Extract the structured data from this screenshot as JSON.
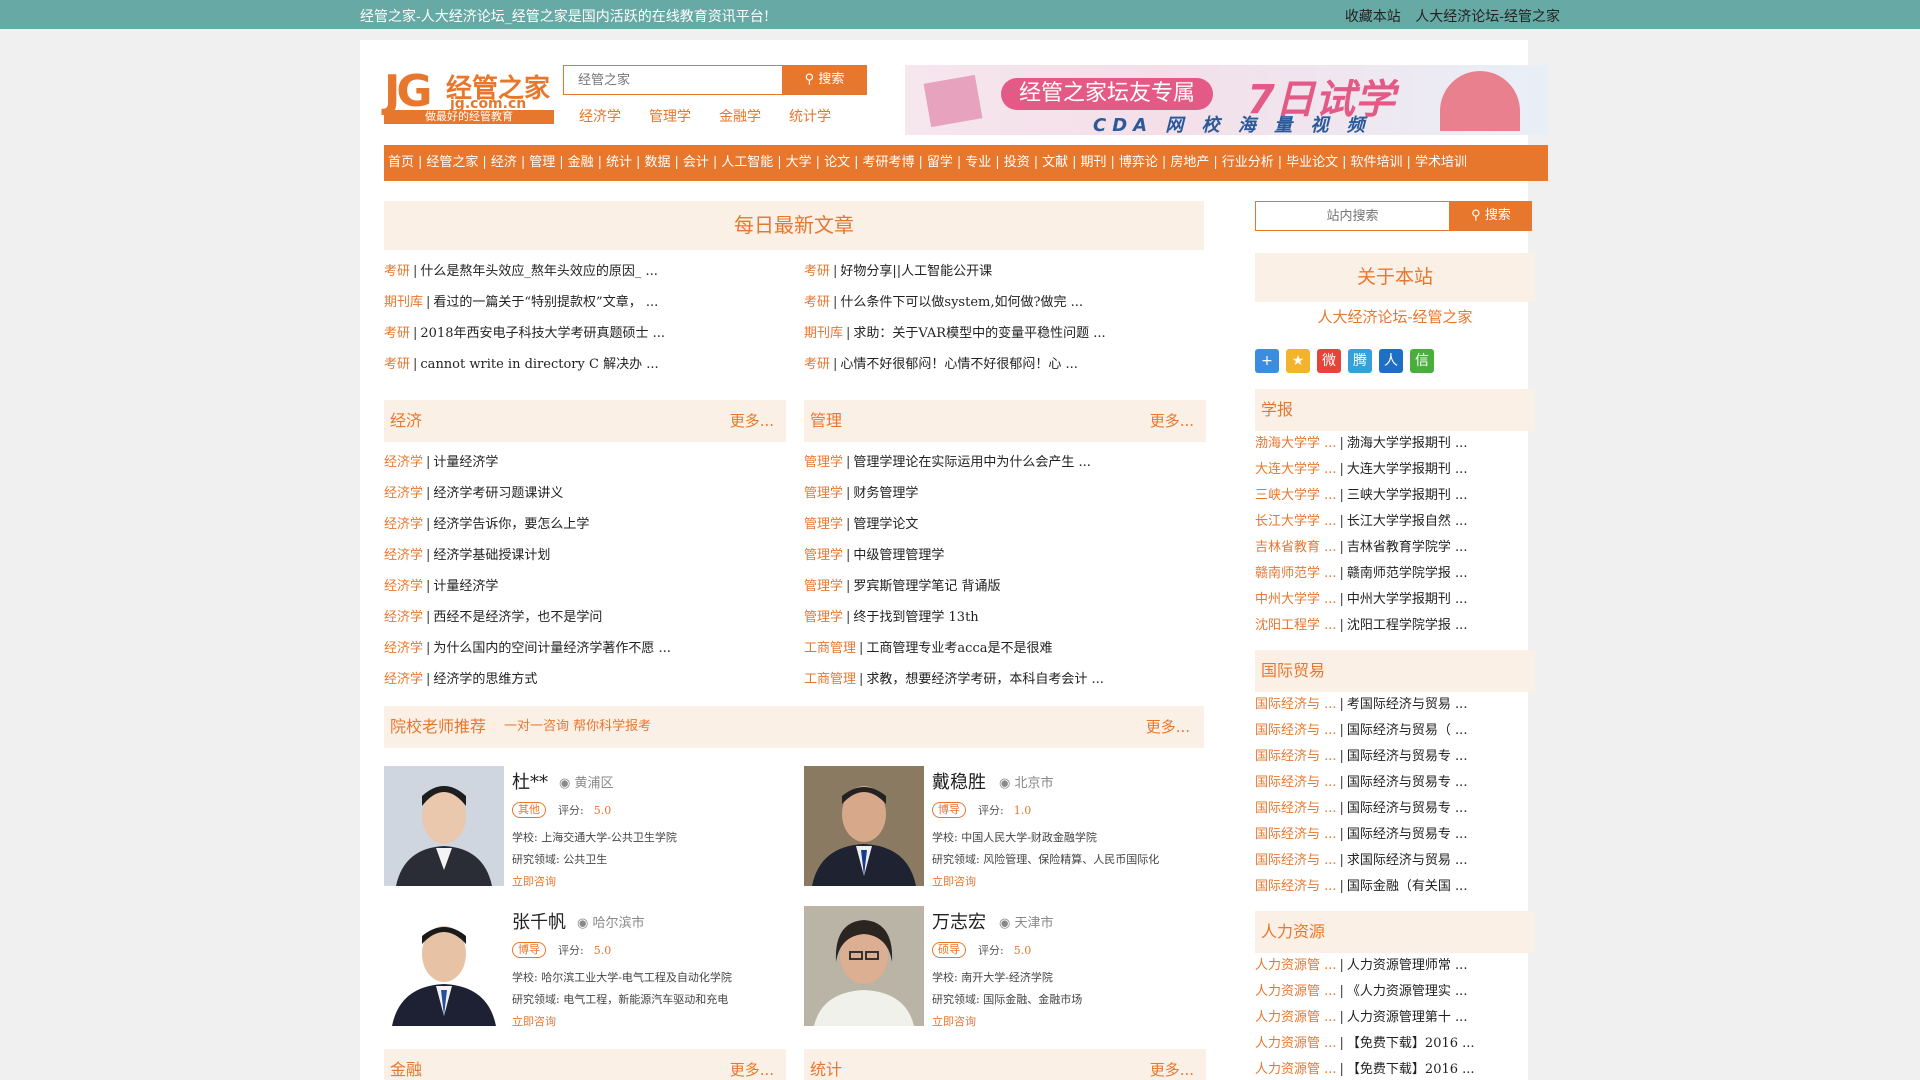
{
  "topbar": {
    "slogan": "经管之家-人大经济论坛_经管之家是国内活跃的在线教育资讯平台!",
    "bookmark": "收藏本站",
    "site_name": "人大经济论坛-经管之家"
  },
  "logo": {
    "jg": "JG",
    "cn": "经管之家",
    "url": "jg.com.cn",
    "tagline": "做最好的经管教育"
  },
  "search": {
    "placeholder": "经管之家",
    "button": "搜索"
  },
  "subnav": [
    "经济学",
    "管理学",
    "金融学",
    "统计学"
  ],
  "banner": {
    "pill": "经管之家坛友专属",
    "big": "7日试学",
    "sub": "CDA 网 校 海 量 视 频"
  },
  "mainnav": [
    "首页",
    "经管之家",
    "经济",
    "管理",
    "金融",
    "统计",
    "数据",
    "会计",
    "人工智能",
    "大学",
    "论文",
    "考研考博",
    "留学",
    "专业",
    "投资",
    "文献",
    "期刊",
    "博弈论",
    "房地产",
    "行业分析",
    "毕业论文",
    "软件培训",
    "学术培训"
  ],
  "daily": {
    "title": "每日最新文章",
    "left": [
      {
        "cat": "考研",
        "title": "什么是熬年头效应_熬年头效应的原因_ ..."
      },
      {
        "cat": "期刊库",
        "title": "看过的一篇关于“特别提款权”文章， ..."
      },
      {
        "cat": "考研",
        "title": "2018年西安电子科技大学考研真题硕士 ..."
      },
      {
        "cat": "考研",
        "title": "cannot write in directory C 解决办 ..."
      }
    ],
    "right": [
      {
        "cat": "考研",
        "title": "好物分享||人工智能公开课"
      },
      {
        "cat": "考研",
        "title": "什么条件下可以做system,如何做?做完 ..."
      },
      {
        "cat": "期刊库",
        "title": "求助：关于VAR模型中的变量平稳性问题 ..."
      },
      {
        "cat": "考研",
        "title": "心情不好很郁闷！心情不好很郁闷！心 ..."
      }
    ]
  },
  "econ": {
    "title": "经济",
    "more": "更多...",
    "items": [
      {
        "cat": "经济学",
        "title": "计量经济学"
      },
      {
        "cat": "经济学",
        "title": "经济学考研习题课讲义"
      },
      {
        "cat": "经济学",
        "title": "经济学告诉你，要怎么上学"
      },
      {
        "cat": "经济学",
        "title": "经济学基础授课计划"
      },
      {
        "cat": "经济学",
        "title": "计量经济学"
      },
      {
        "cat": "经济学",
        "title": "西经不是经济学，也不是学问"
      },
      {
        "cat": "经济学",
        "title": "为什么国内的空间计量经济学著作不愿 ..."
      },
      {
        "cat": "经济学",
        "title": "经济学的思维方式"
      }
    ]
  },
  "mgmt": {
    "title": "管理",
    "more": "更多...",
    "items": [
      {
        "cat": "管理学",
        "title": "管理学理论在实际运用中为什么会产生 ..."
      },
      {
        "cat": "管理学",
        "title": "财务管理学"
      },
      {
        "cat": "管理学",
        "title": "管理学论文"
      },
      {
        "cat": "管理学",
        "title": "中级管理管理学"
      },
      {
        "cat": "管理学",
        "title": "罗宾斯管理学笔记 背诵版"
      },
      {
        "cat": "管理学",
        "title": "终于找到管理学 13th"
      },
      {
        "cat": "工商管理",
        "title": "工商管理专业考acca是不是很难"
      },
      {
        "cat": "工商管理",
        "title": "求教，想要经济学考研，本科自考会计 ..."
      }
    ]
  },
  "teachers": {
    "title": "院校老师推荐",
    "subtitle": "一对一咨询 帮你科学报考",
    "more": "更多...",
    "list": [
      {
        "name": "杜**",
        "loc": "黄浦区",
        "badge": "其他",
        "score_label": "评分:",
        "score": "5.0",
        "school": "学校:  上海交通大学-公共卫生学院",
        "field": "研究领域:  公共卫生",
        "consult": "立即咨询"
      },
      {
        "name": "戴稳胜",
        "loc": "北京市",
        "badge": "博导",
        "score_label": "评分:",
        "score": "1.0",
        "school": "学校:  中国人民大学-财政金融学院",
        "field": "研究领域:  风险管理、保险精算、人民币国际化",
        "consult": "立即咨询"
      },
      {
        "name": "张千帆",
        "loc": "哈尔滨市",
        "badge": "博导",
        "score_label": "评分:",
        "score": "5.0",
        "school": "学校:  哈尔滨工业大学-电气工程及自动化学院",
        "field": "研究领域:  电气工程，新能源汽车驱动和充电",
        "consult": "立即咨询"
      },
      {
        "name": "万志宏",
        "loc": "天津市",
        "badge": "硕导",
        "score_label": "评分:",
        "score": "5.0",
        "school": "学校:  南开大学-经济学院",
        "field": "研究领域:  国际金融、金融市场",
        "consult": "立即咨询"
      }
    ]
  },
  "finance": {
    "title": "金融",
    "more": "更多..."
  },
  "stats": {
    "title": "统计",
    "more": "更多..."
  },
  "sidebar": {
    "search_placeholder": "站内搜索",
    "search_button": "搜索",
    "about_title": "关于本站",
    "about_sub": "人大经济论坛-经管之家",
    "share_icons": [
      {
        "name": "share-more-icon",
        "glyph": "+",
        "color": "#3b8de0"
      },
      {
        "name": "qzone-icon",
        "glyph": "★",
        "color": "#f3b42b"
      },
      {
        "name": "weibo-icon",
        "glyph": "微",
        "color": "#e6443a"
      },
      {
        "name": "tencent-weibo-icon",
        "glyph": "腾",
        "color": "#35a1d8"
      },
      {
        "name": "renren-icon",
        "glyph": "人",
        "color": "#1f6fc4"
      },
      {
        "name": "wechat-icon",
        "glyph": "信",
        "color": "#4aae3c"
      }
    ],
    "journals": {
      "title": "学报",
      "items": [
        {
          "cat": "渤海大学学 ...",
          "title": "渤海大学学报期刊 ..."
        },
        {
          "cat": "大连大学学 ...",
          "title": "大连大学学报期刊 ..."
        },
        {
          "cat": "三峡大学学 ...",
          "title": "三峡大学学报期刊 ..."
        },
        {
          "cat": "长江大学学 ...",
          "title": "长江大学学报自然 ..."
        },
        {
          "cat": "吉林省教育 ...",
          "title": "吉林省教育学院学 ..."
        },
        {
          "cat": "赣南师范学 ...",
          "title": "赣南师范学院学报 ..."
        },
        {
          "cat": "中州大学学 ...",
          "title": "中州大学学报期刊 ..."
        },
        {
          "cat": "沈阳工程学 ...",
          "title": "沈阳工程学院学报 ..."
        }
      ]
    },
    "trade": {
      "title": "国际贸易",
      "items": [
        {
          "cat": "国际经济与 ...",
          "title": "考国际经济与贸易 ..."
        },
        {
          "cat": "国际经济与 ...",
          "title": "国际经济与贸易（ ..."
        },
        {
          "cat": "国际经济与 ...",
          "title": "国际经济与贸易专 ..."
        },
        {
          "cat": "国际经济与 ...",
          "title": "国际经济与贸易专 ..."
        },
        {
          "cat": "国际经济与 ...",
          "title": "国际经济与贸易专 ..."
        },
        {
          "cat": "国际经济与 ...",
          "title": "国际经济与贸易专 ..."
        },
        {
          "cat": "国际经济与 ...",
          "title": "求国际经济与贸易 ..."
        },
        {
          "cat": "国际经济与 ...",
          "title": "国际金融（有关国 ..."
        }
      ]
    },
    "hr": {
      "title": "人力资源",
      "items": [
        {
          "cat": "人力资源管 ...",
          "title": "人力资源管理师常 ..."
        },
        {
          "cat": "人力资源管 ...",
          "title": "《人力资源管理实 ..."
        },
        {
          "cat": "人力资源管 ...",
          "title": "人力资源管理第十 ..."
        },
        {
          "cat": "人力资源管 ...",
          "title": "【免费下载】2016 ..."
        },
        {
          "cat": "人力资源管 ...",
          "title": "【免费下载】2016 ..."
        }
      ]
    }
  },
  "colors": {
    "accent": "#e8772e",
    "topbar": "#67a9a4",
    "panel": "#fbf0e6"
  }
}
